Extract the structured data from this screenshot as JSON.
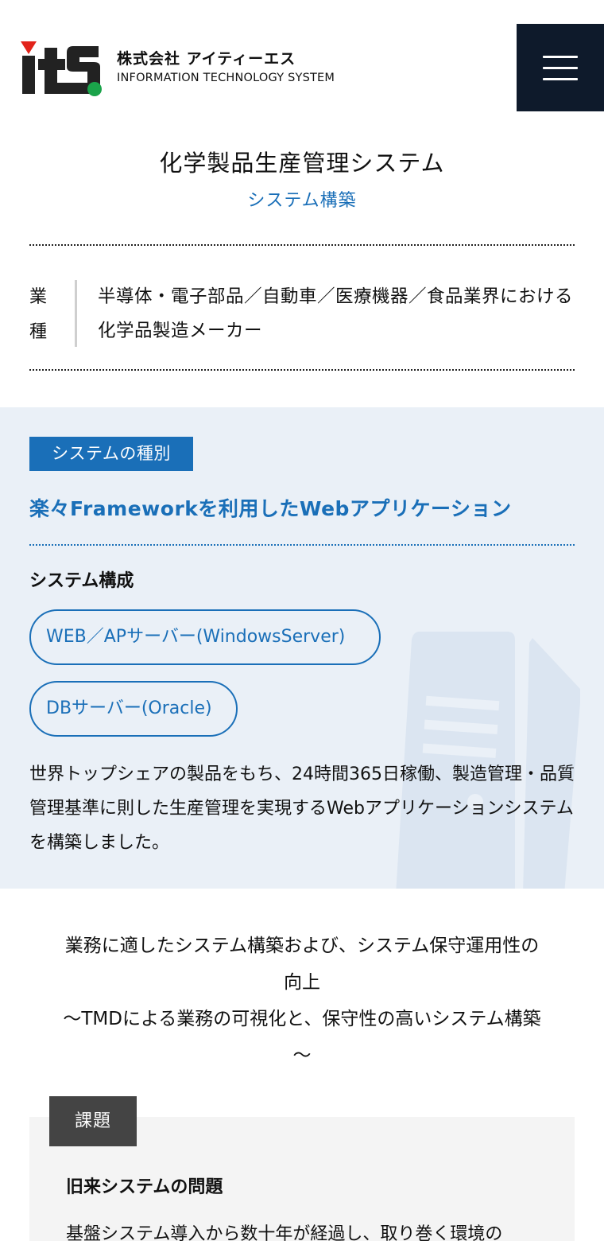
{
  "header": {
    "company_name_jp": "株式会社 アイティーエス",
    "company_name_en": "INFORMATION TECHNOLOGY SYSTEM",
    "logo_text": "itS",
    "menu_icon": "hamburger-icon"
  },
  "case": {
    "title": "化学製品生産管理システム",
    "category": "システム構築",
    "industry_label_top": "業",
    "industry_label_bottom": "種",
    "industry_text": "半導体・電子部品／自動車／医療機器／食品業界における化学品製造メーカー"
  },
  "system": {
    "type_badge": "システムの種別",
    "type_value": "楽々Frameworkを利用したWebアプリケーション",
    "config_title": "システム構成",
    "components": [
      "WEB／APサーバー(WindowsServer)",
      "DBサーバー(Oracle)"
    ],
    "description": "世界トップシェアの製品をもち、24時間365日稼働、製造管理・品質管理基準に則した生産管理を実現するWebアプリケーションシステムを構築しました。"
  },
  "catch": {
    "line1": "業務に適したシステム構築および、システム保守運用性の",
    "line2": "向上",
    "line3": "～TMDによる業務の可視化と、保守性の高いシステム構築",
    "line4": "～"
  },
  "issue": {
    "badge": "課題",
    "title": "旧来システムの問題",
    "text": "基盤システム導入から数十年が経過し、取り巻く環境の"
  },
  "colors": {
    "accent_blue": "#1a6fb8",
    "navy": "#0e1a2b",
    "section_bg": "#eaf0f7",
    "logo_red": "#e2231a",
    "logo_green": "#1aa34a"
  }
}
